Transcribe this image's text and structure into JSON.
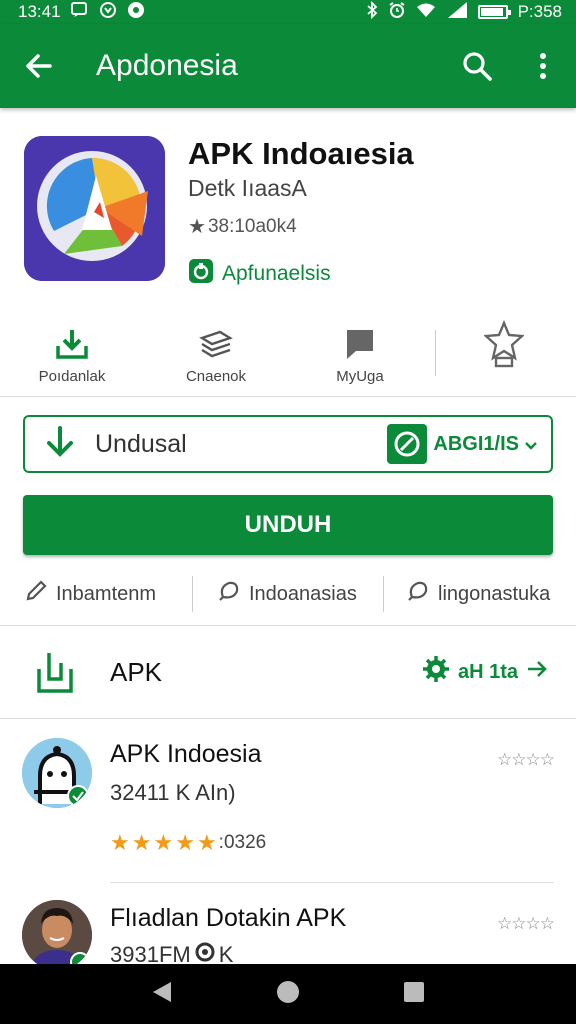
{
  "status_bar": {
    "time": "13:41",
    "right_text": "P:358",
    "battery_level": 0.85,
    "icons": [
      "notification-icon",
      "alarm-icon",
      "dot-icon",
      "bluetooth-icon",
      "alarm-clock-icon",
      "wifi-icon",
      "signal-icon",
      "battery-icon"
    ]
  },
  "app_bar": {
    "title": "Apdonesia",
    "icons": [
      "back-arrow-icon",
      "search-icon",
      "more-vert-icon"
    ]
  },
  "app": {
    "name": "APK Indoaıesia",
    "developer": "Detk IıaasA",
    "rating_text": "38:10a0k4",
    "badge_text": "Apfunaelsis"
  },
  "action_items": [
    {
      "label": "Poıdanlak",
      "icon": "download-tray-icon"
    },
    {
      "label": "Cnaenok",
      "icon": "layers-icon"
    },
    {
      "label": "MyUga",
      "icon": "bookmark-icon"
    },
    {
      "label": "",
      "icon": "star-trophy-icon"
    }
  ],
  "version_select": {
    "label": "Undusal",
    "version": "ABGI1/IS",
    "icons": [
      "download-arrow-icon",
      "app-chip-icon",
      "dropdown-caret-icon"
    ]
  },
  "download_button": {
    "label": "UNDUH"
  },
  "tags": [
    {
      "label": "Inbamtenm",
      "icon": "pencil-icon"
    },
    {
      "label": "Indoanasias",
      "icon": "tag-icon"
    },
    {
      "label": "lingonastuka",
      "icon": "tag-icon"
    }
  ],
  "apk_row": {
    "label": "APK",
    "more_text": "aH 1ta",
    "icons": [
      "apk-file-icon",
      "gear-icon",
      "arrow-right-icon"
    ]
  },
  "reviews": [
    {
      "name": "APK Indoesia",
      "sub": "32411 K AIn)",
      "stars": 5,
      "rating_text": ":0326",
      "small_stars": "☆☆☆☆",
      "avatar": "robot-avatar"
    },
    {
      "name": "Flıadlan Dotakin APK",
      "sub": "3931FM",
      "sub_after_icon": "K",
      "small_stars": "☆☆☆☆",
      "avatar": "person-avatar"
    }
  ],
  "nav_bar": {
    "icons": [
      "back-triangle-icon",
      "home-circle-icon",
      "recents-square-icon"
    ]
  },
  "colors": {
    "primary": "#0b8a3a",
    "star": "#f29a1a",
    "nav": "#000000"
  }
}
